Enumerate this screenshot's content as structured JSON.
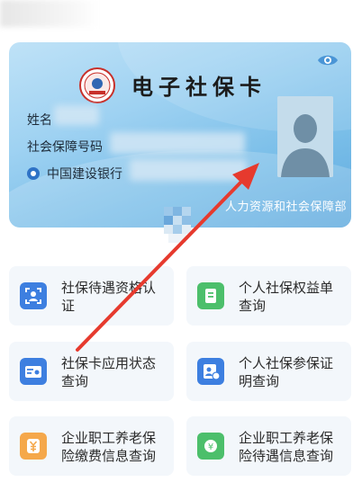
{
  "card": {
    "title": "电子社保卡",
    "name_label": "姓名",
    "ssn_label": "社会保障号码",
    "bank": "中国建设银行",
    "ministry": "人力资源和社会保障部"
  },
  "services": [
    {
      "label": "社保待遇资格认证",
      "icon": "face-scan-icon",
      "color": "#3d7fe0"
    },
    {
      "label": "个人社保权益单查询",
      "icon": "document-icon",
      "color": "#4cbf6b"
    },
    {
      "label": "社保卡应用状态查询",
      "icon": "card-icon",
      "color": "#3d7fe0"
    },
    {
      "label": "个人社保参保证明查询",
      "icon": "certificate-icon",
      "color": "#3d7fe0"
    },
    {
      "label": "企业职工养老保险缴费信息查询",
      "icon": "yuan-icon",
      "color": "#f5a84a"
    },
    {
      "label": "企业职工养老保险待遇信息查询",
      "icon": "pension-icon",
      "color": "#4cbf6b"
    }
  ],
  "colors": {
    "arrow": "#e63a2e",
    "card_accent": "#5ea9de"
  }
}
